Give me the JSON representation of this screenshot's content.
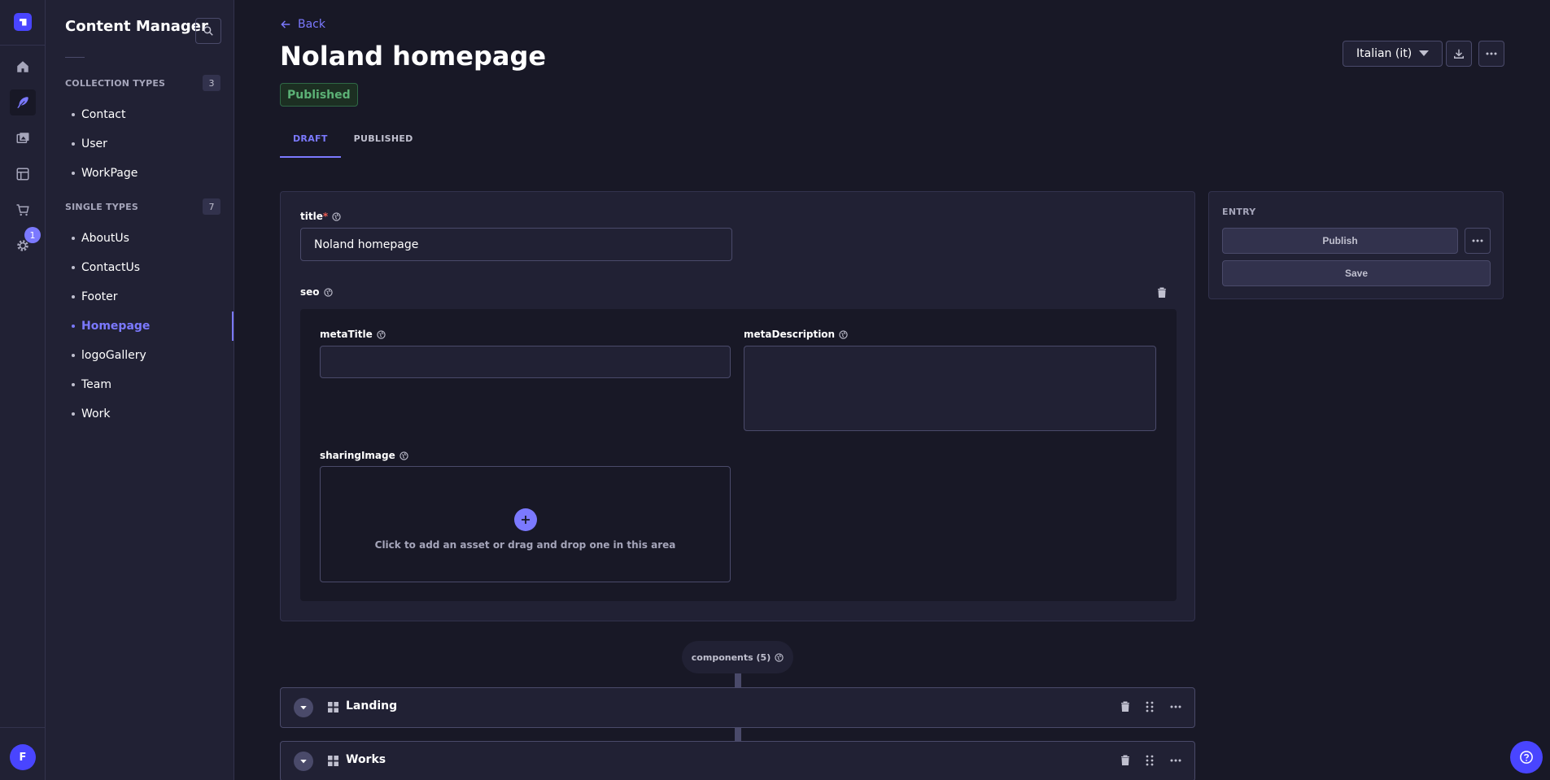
{
  "app": {
    "avatar_initial": "F",
    "settings_badge": "1"
  },
  "sidebar": {
    "title": "Content Manager",
    "collection_types": {
      "label": "COLLECTION TYPES",
      "count": "3",
      "items": [
        {
          "label": "Contact"
        },
        {
          "label": "User"
        },
        {
          "label": "WorkPage"
        }
      ]
    },
    "single_types": {
      "label": "SINGLE TYPES",
      "count": "7",
      "items": [
        {
          "label": "AboutUs"
        },
        {
          "label": "ContactUs"
        },
        {
          "label": "Footer"
        },
        {
          "label": "Homepage"
        },
        {
          "label": "logoGallery"
        },
        {
          "label": "Team"
        },
        {
          "label": "Work"
        }
      ]
    }
  },
  "header": {
    "back_label": "Back",
    "title": "Noland homepage",
    "status": "Published",
    "locale": "Italian (it)"
  },
  "tabs": [
    {
      "label": "DRAFT"
    },
    {
      "label": "PUBLISHED"
    }
  ],
  "form": {
    "title_label": "title",
    "title_required_mark": "*",
    "title_value": "Noland homepage",
    "seo_label": "seo",
    "meta_title_label": "metaTitle",
    "meta_title_value": "",
    "meta_description_label": "metaDescription",
    "meta_description_value": "",
    "sharing_image_label": "sharingImage",
    "dropzone_text": "Click to add an asset or drag and drop one in this area"
  },
  "entry_panel": {
    "label": "ENTRY",
    "publish_label": "Publish",
    "save_label": "Save"
  },
  "components": {
    "label": "components (5)",
    "items": [
      {
        "name": "Landing"
      },
      {
        "name": "Works"
      }
    ]
  },
  "colors": {
    "accent": "#7b79ff",
    "primary": "#4945ff",
    "published_green": "#5cb176",
    "background": "#181826",
    "surface": "#212134"
  }
}
